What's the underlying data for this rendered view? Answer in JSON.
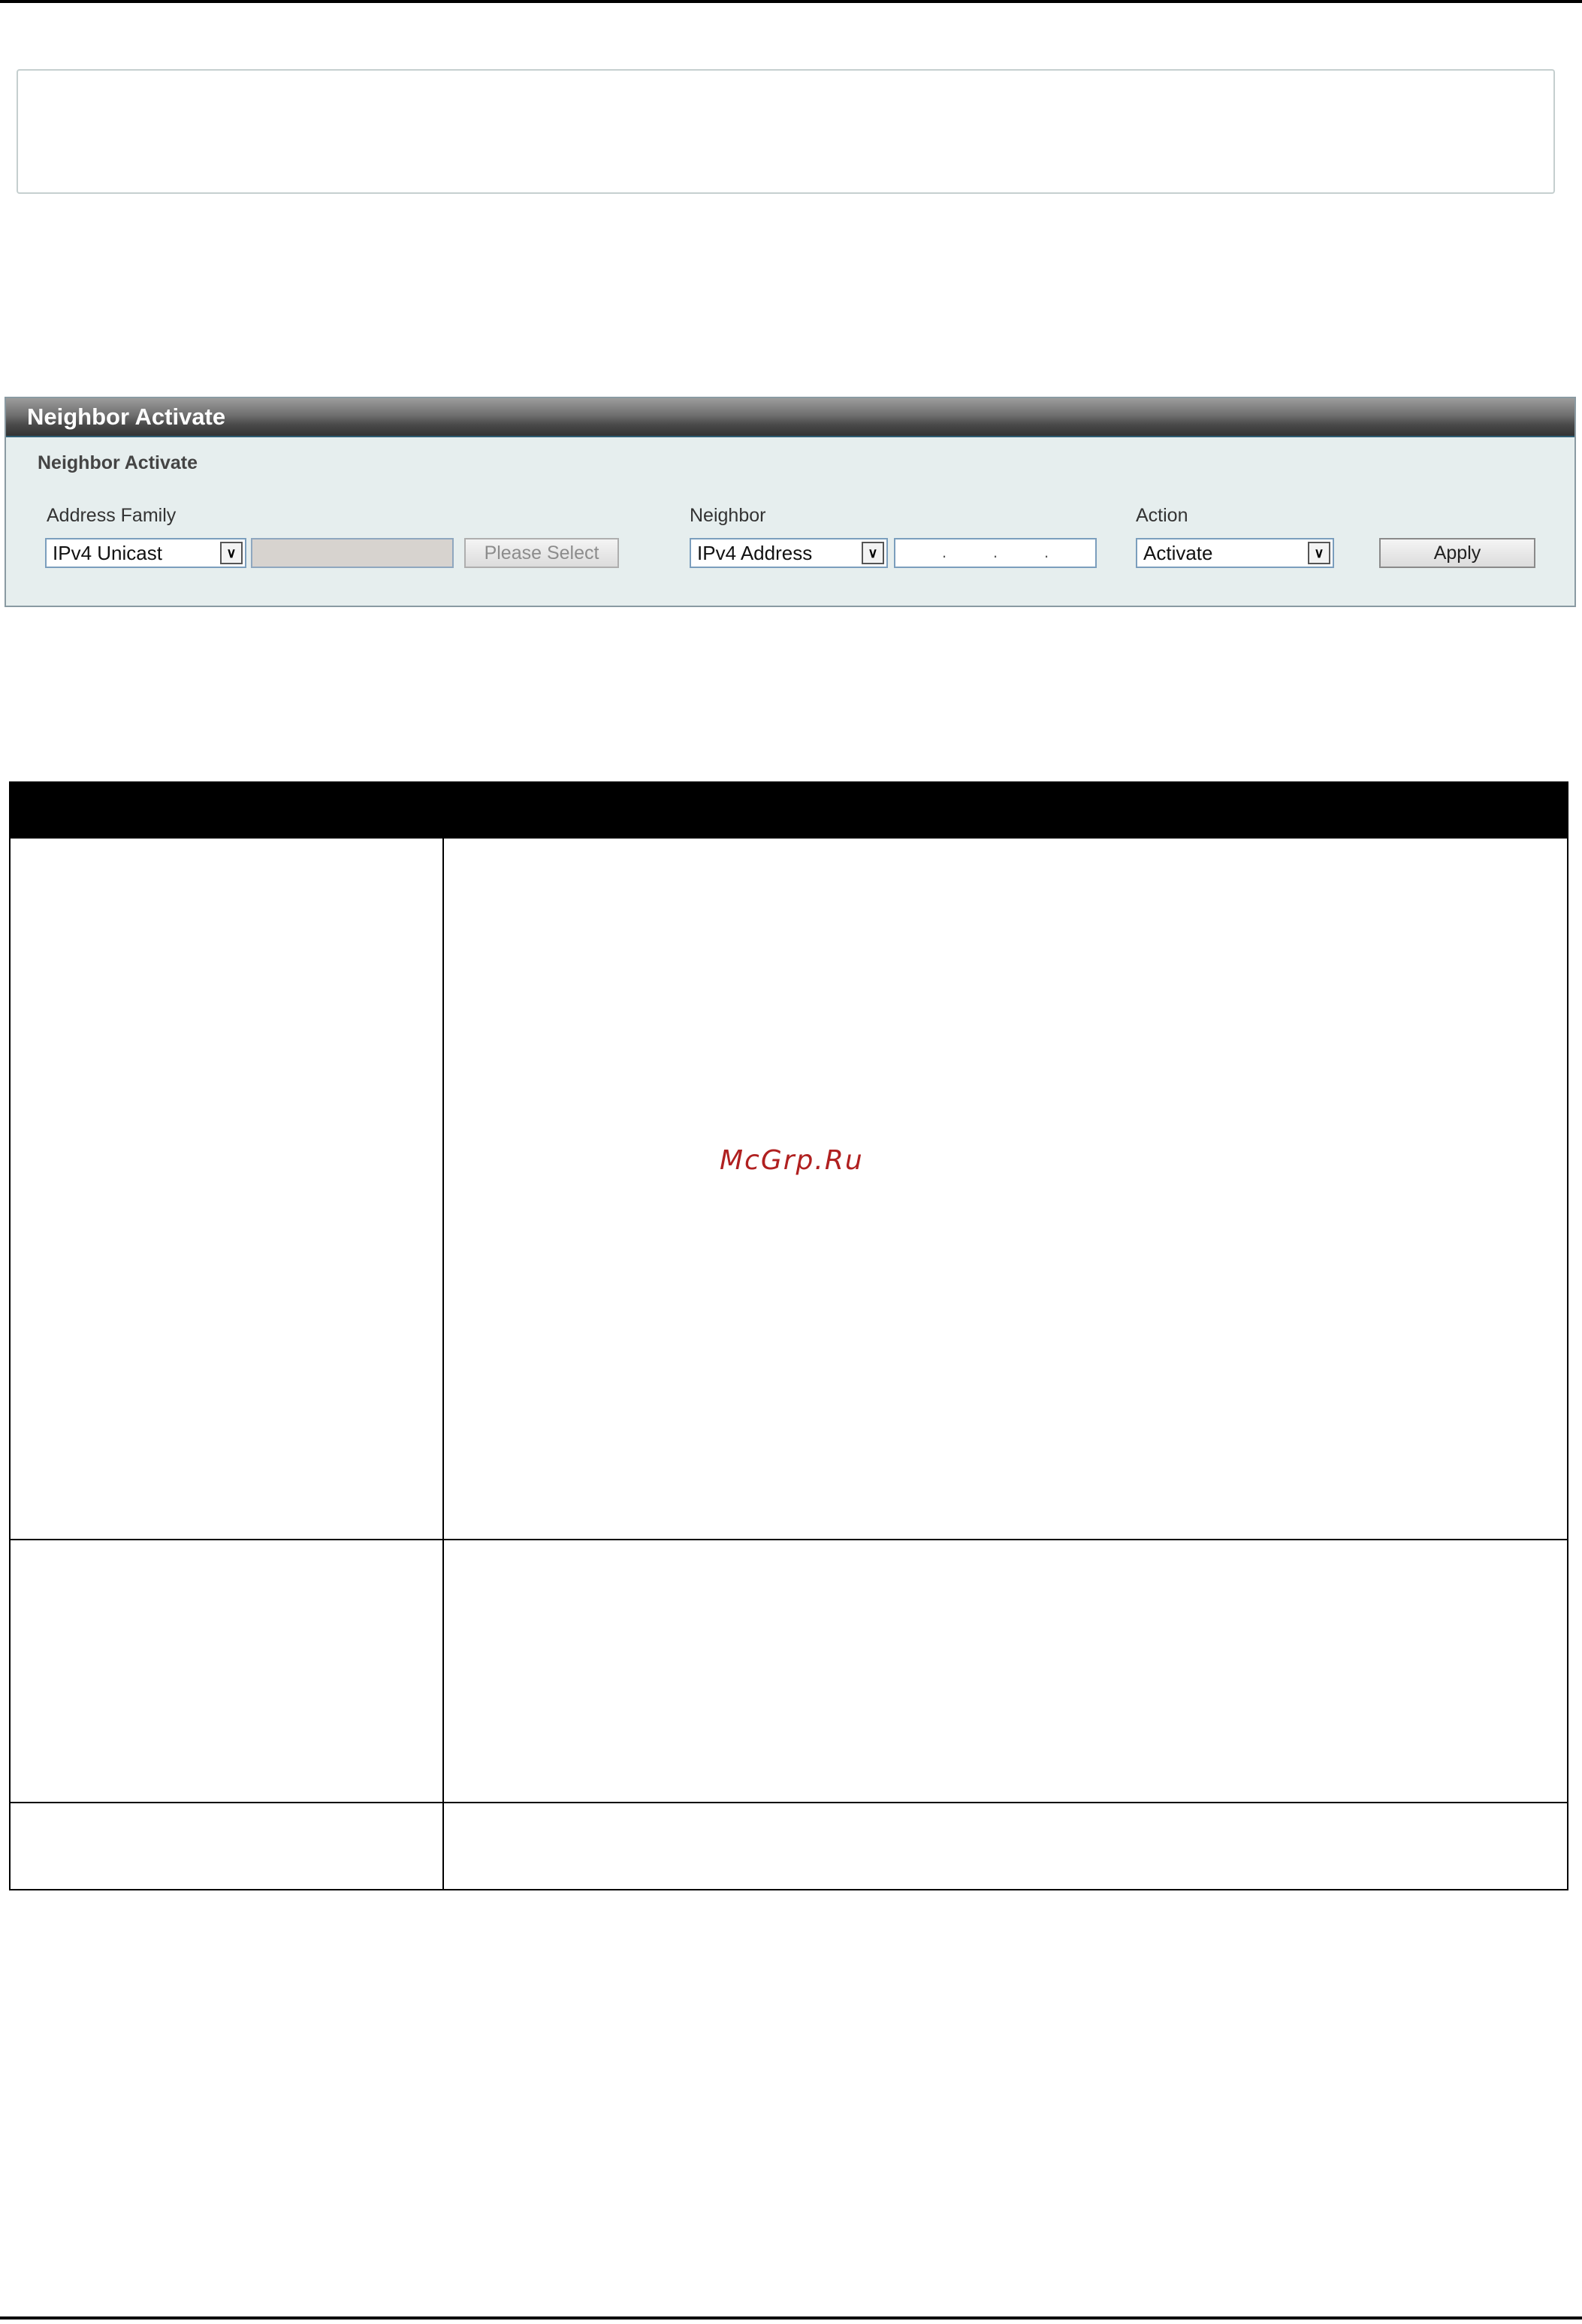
{
  "panel": {
    "title": "Neighbor Activate",
    "legend": "Neighbor Activate",
    "fields": {
      "address_family_label": "Address Family",
      "address_family_value": "IPv4 Unicast",
      "please_select_label": "Please Select",
      "neighbor_label": "Neighbor",
      "neighbor_type_value": "IPv4 Address",
      "neighbor_ip_value": ". . .",
      "action_label": "Action",
      "action_value": "Activate",
      "apply_label": "Apply"
    }
  },
  "table": {
    "headers": [
      "",
      ""
    ],
    "rows": [
      {
        "parameter": "",
        "description": ""
      },
      {
        "parameter": "",
        "description": ""
      },
      {
        "parameter": "",
        "description": ""
      }
    ]
  },
  "watermark": "McGrp.Ru",
  "colors": {
    "panel_background": "#e6eeee",
    "header_border": "#2f5e74",
    "table_header": "#000000",
    "watermark": "#b02020"
  },
  "icons": {
    "dropdown_arrow": "chevron-down-icon"
  }
}
